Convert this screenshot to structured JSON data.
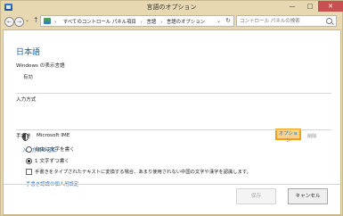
{
  "window": {
    "title": "言語のオプション",
    "controls": [
      "—",
      "□",
      "✕"
    ]
  },
  "navigation": {
    "back": "←",
    "forward": "→",
    "caret": "⌄",
    "up": "↑",
    "breadcrumbs": [
      "すべてのコントロール パネル項目",
      "言語",
      "言語のオプション"
    ],
    "separator": "›",
    "dropdown": "⌄",
    "refresh": "↻",
    "search_placeholder": "コントロール パネルの検索"
  },
  "content": {
    "page_title": "日本語",
    "windows_display_language": {
      "label": "Windows の表示言語",
      "value": "有効"
    },
    "input_method": {
      "label": "入力方式",
      "name": "Microsoft IME",
      "option_label": "オプション",
      "delete_label": "削除",
      "add_label": "入力方式の追加"
    },
    "handwriting": {
      "label": "手書き",
      "options": [
        "自由に文字を書く",
        "1 文字ずつ書く"
      ],
      "checkbox": "手書きをタイプされたテキストに変換する場合、あまり使用されない中国の文字や漢字を認識します。",
      "personalize_link": "手書き認識の個人用設定"
    }
  },
  "footer": {
    "save": "保存",
    "cancel": "キャンセル"
  },
  "colors": {
    "accent": "#1f6fc4",
    "highlight": "#f8d28b",
    "highlight_border": "#f1a11d"
  }
}
